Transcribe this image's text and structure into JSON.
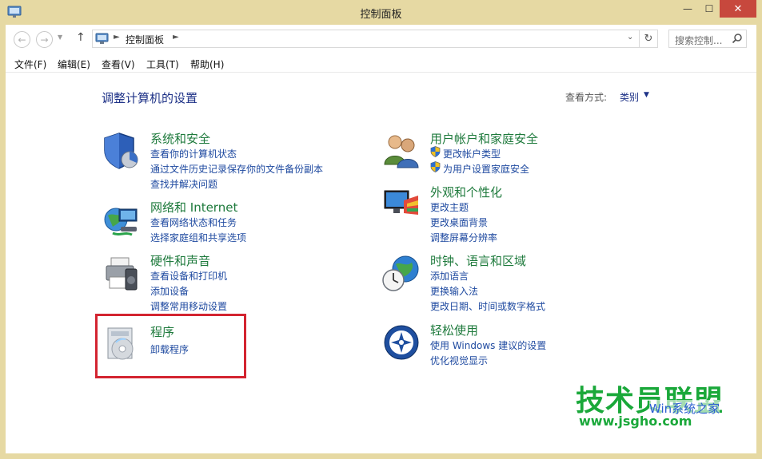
{
  "window": {
    "title": "控制面板",
    "minimize_glyph": "—",
    "maximize_glyph": "☐",
    "close_glyph": "✕"
  },
  "navigation": {
    "back_glyph": "←",
    "forward_glyph": "→",
    "recent_glyph": "▼",
    "up_glyph": "↑",
    "breadcrumb_sep": "►",
    "breadcrumb": "控制面板",
    "dropdown_glyph": "⌄",
    "refresh_glyph": "↻",
    "search_placeholder": "搜索控制..."
  },
  "menu": [
    "文件(F)",
    "编辑(E)",
    "查看(V)",
    "工具(T)",
    "帮助(H)"
  ],
  "main": {
    "heading": "调整计算机的设置",
    "view_by_label": "查看方式:",
    "view_by_value": "类别",
    "view_by_arrow": "▼"
  },
  "categories": [
    {
      "title": "系统和安全",
      "icon": "system-security-icon",
      "links": [
        "查看你的计算机状态",
        "通过文件历史记录保存你的文件备份副本",
        "查找并解决问题"
      ]
    },
    {
      "title": "网络和 Internet",
      "icon": "network-icon",
      "links": [
        "查看网络状态和任务",
        "选择家庭组和共享选项"
      ]
    },
    {
      "title": "硬件和声音",
      "icon": "hardware-printer-icon",
      "links": [
        "查看设备和打印机",
        "添加设备",
        "调整常用移动设置"
      ]
    },
    {
      "title": "程序",
      "icon": "programs-icon",
      "links": [
        "卸载程序"
      ]
    },
    {
      "title": "用户帐户和家庭安全",
      "icon": "users-icon",
      "links": [
        "更改帐户类型",
        "为用户设置家庭安全"
      ]
    },
    {
      "title": "外观和个性化",
      "icon": "appearance-icon",
      "links": [
        "更改主题",
        "更改桌面背景",
        "调整屏幕分辨率"
      ]
    },
    {
      "title": "时钟、语言和区域",
      "icon": "clock-globe-icon",
      "links": [
        "添加语言",
        "更换输入法",
        "更改日期、时间或数字格式"
      ]
    },
    {
      "title": "轻松使用",
      "icon": "ease-of-access-icon",
      "links": [
        "使用 Windows 建议的设置",
        "优化视觉显示"
      ]
    }
  ],
  "watermark": {
    "brand": "技术员联盟",
    "subtitle": "Win系统之家",
    "url": "www.jsgho.com"
  },
  "colors": {
    "frame": "#e6d9a3",
    "close_button": "#c7483d",
    "category_title": "#1e7a3c",
    "link": "#1f4aa0",
    "heading": "#1e3287",
    "highlight": "#d32430"
  }
}
